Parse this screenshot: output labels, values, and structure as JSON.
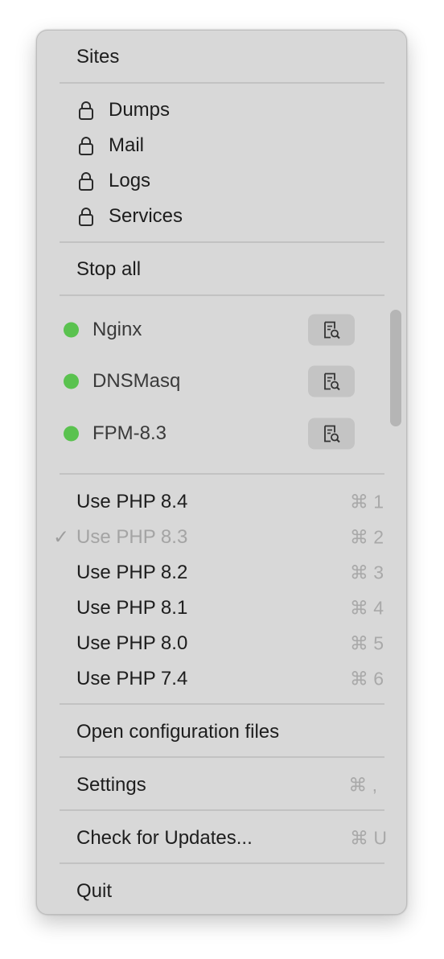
{
  "menu": {
    "sites": "Sites",
    "locked_items": [
      {
        "label": "Dumps"
      },
      {
        "label": "Mail"
      },
      {
        "label": "Logs"
      },
      {
        "label": "Services"
      }
    ],
    "stop_all": "Stop all",
    "services": [
      {
        "label": "Nginx",
        "status": "running",
        "icon": "log-search-icon"
      },
      {
        "label": "DNSMasq",
        "status": "running",
        "icon": "log-search-icon"
      },
      {
        "label": "FPM-8.3",
        "status": "running",
        "icon": "log-search-icon"
      }
    ],
    "php_versions": [
      {
        "label": "Use PHP 8.4",
        "shortcut": "⌘ 1",
        "checked": false
      },
      {
        "label": "Use PHP 8.3",
        "shortcut": "⌘ 2",
        "checked": true,
        "check_mark": "✓"
      },
      {
        "label": "Use PHP 8.2",
        "shortcut": "⌘ 3",
        "checked": false
      },
      {
        "label": "Use PHP 8.1",
        "shortcut": "⌘ 4",
        "checked": false
      },
      {
        "label": "Use PHP 8.0",
        "shortcut": "⌘ 5",
        "checked": false
      },
      {
        "label": "Use PHP 7.4",
        "shortcut": "⌘ 6",
        "checked": false
      }
    ],
    "open_config": "Open configuration files",
    "settings": {
      "label": "Settings",
      "shortcut": "⌘ ,"
    },
    "check_updates": {
      "label": "Check for Updates...",
      "shortcut": "⌘ U"
    },
    "quit": "Quit"
  },
  "colors": {
    "status_running": "#5ac24f",
    "menu_background": "#d8d8d8"
  }
}
